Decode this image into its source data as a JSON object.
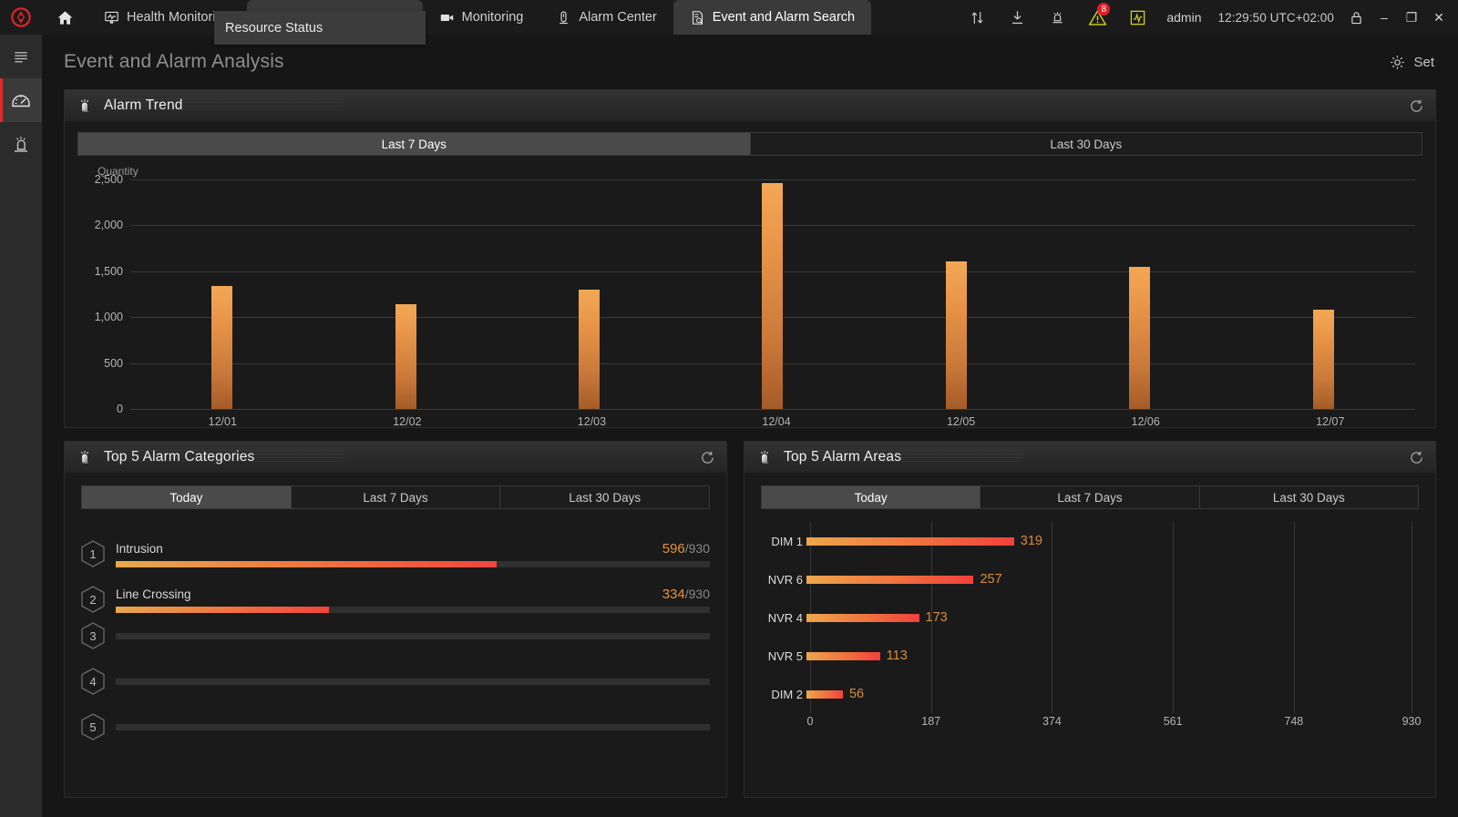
{
  "topbar": {
    "logo_color": "#e0232b",
    "home_icon": "home-icon",
    "tabs": [
      {
        "label": "Health Monitoring",
        "icon": "health-monitor-icon",
        "active": false,
        "closable": false
      },
      {
        "label": "Resource Status",
        "icon": "resource-status-icon",
        "active": true,
        "closable": true
      },
      {
        "label": "Monitoring",
        "icon": "camera-icon",
        "active": false,
        "closable": false
      },
      {
        "label": "Alarm Center",
        "icon": "alarm-tower-icon",
        "active": false,
        "closable": false
      },
      {
        "label": "Event and Alarm Search",
        "icon": "event-search-icon",
        "active": true,
        "closable": false
      }
    ],
    "close_glyph": "×",
    "sys_icons": [
      {
        "name": "transfer-icon"
      },
      {
        "name": "download-icon"
      },
      {
        "name": "alarm-bell-icon"
      },
      {
        "name": "warning-triangle-icon",
        "badge": "8",
        "badge_color": "#e01f26",
        "color": "#d8d419"
      },
      {
        "name": "signal-chart-icon",
        "color": "#d8d419"
      }
    ],
    "user": "admin",
    "clock": "12:29:50 UTC+02:00",
    "lock_icon": "lock-icon",
    "minimize": "–",
    "maximize": "❐",
    "close": "✕"
  },
  "tooltip": {
    "text": "Resource Status"
  },
  "rail": {
    "items": [
      {
        "name": "menu-icon",
        "active": false
      },
      {
        "name": "dashboard-gauge-icon",
        "active": true
      },
      {
        "name": "alarm-siren-icon",
        "active": false
      }
    ]
  },
  "page": {
    "title": "Event and Alarm Analysis",
    "set_label": "Set",
    "set_icon": "gear-icon"
  },
  "alarm_trend": {
    "title": "Alarm Trend",
    "icon": "alarm-bell-icon",
    "refresh_icon": "refresh-icon",
    "ranges": [
      {
        "label": "Last 7 Days",
        "active": true
      },
      {
        "label": "Last 30 Days",
        "active": false
      }
    ]
  },
  "alarm_categories": {
    "title": "Top 5 Alarm Categories",
    "icon": "alarm-bell-icon",
    "refresh_icon": "refresh-icon",
    "ranges": [
      {
        "label": "Today",
        "active": true
      },
      {
        "label": "Last 7 Days",
        "active": false
      },
      {
        "label": "Last 30 Days",
        "active": false
      }
    ],
    "total": 930,
    "rows": [
      {
        "rank": "1",
        "name": "Intrusion",
        "value": 596,
        "value_text": "596",
        "total_text": "/930"
      },
      {
        "rank": "2",
        "name": "Line Crossing",
        "value": 334,
        "value_text": "334",
        "total_text": "/930"
      },
      {
        "rank": "3",
        "name": "",
        "value": 0,
        "value_text": "",
        "total_text": ""
      },
      {
        "rank": "4",
        "name": "",
        "value": 0,
        "value_text": "",
        "total_text": ""
      },
      {
        "rank": "5",
        "name": "",
        "value": 0,
        "value_text": "",
        "total_text": ""
      }
    ]
  },
  "alarm_areas": {
    "title": "Top 5 Alarm Areas",
    "icon": "alarm-bell-icon",
    "refresh_icon": "refresh-icon",
    "ranges": [
      {
        "label": "Today",
        "active": true
      },
      {
        "label": "Last 7 Days",
        "active": false
      },
      {
        "label": "Last 30 Days",
        "active": false
      }
    ]
  },
  "chart_data": [
    {
      "id": "alarm-trend-chart",
      "type": "bar",
      "title": "Alarm Trend",
      "xlabel": "",
      "ylabel": "Quantity",
      "ylim": [
        0,
        2500
      ],
      "yticks": [
        0,
        500,
        1000,
        1500,
        2000,
        2500
      ],
      "ytick_labels": [
        "0",
        "500",
        "1,000",
        "1,500",
        "2,000",
        "2,500"
      ],
      "categories": [
        "12/01",
        "12/02",
        "12/03",
        "12/04",
        "12/05",
        "12/06",
        "12/07"
      ],
      "values": [
        1340,
        1140,
        1300,
        2460,
        1610,
        1550,
        1080
      ],
      "grid": true,
      "legend": "none",
      "bar_color_top": "#f2a855",
      "bar_color_bottom": "#a55c28"
    },
    {
      "id": "alarm-categories-chart",
      "type": "bar",
      "orientation": "horizontal-progress",
      "title": "Top 5 Alarm Categories",
      "categories": [
        "Intrusion",
        "Line Crossing",
        "",
        "",
        ""
      ],
      "values": [
        596,
        334,
        0,
        0,
        0
      ],
      "max": 930,
      "xlabel": "",
      "ylabel": "",
      "grid": false,
      "legend": "none"
    },
    {
      "id": "alarm-areas-chart",
      "type": "bar",
      "orientation": "horizontal",
      "title": "Top 5 Alarm Areas",
      "categories": [
        "DIM 1",
        "NVR 6",
        "NVR 4",
        "NVR 5",
        "DIM 2"
      ],
      "values": [
        319,
        257,
        173,
        113,
        56
      ],
      "value_labels": [
        "319",
        "257",
        "173",
        "113",
        "56"
      ],
      "xlim": [
        0,
        930
      ],
      "xticks": [
        0,
        187,
        374,
        561,
        748,
        930
      ],
      "xtick_labels": [
        "0",
        "187",
        "374",
        "561",
        "748",
        "930"
      ],
      "xlabel": "",
      "ylabel": "",
      "grid": true,
      "legend": "none"
    }
  ]
}
